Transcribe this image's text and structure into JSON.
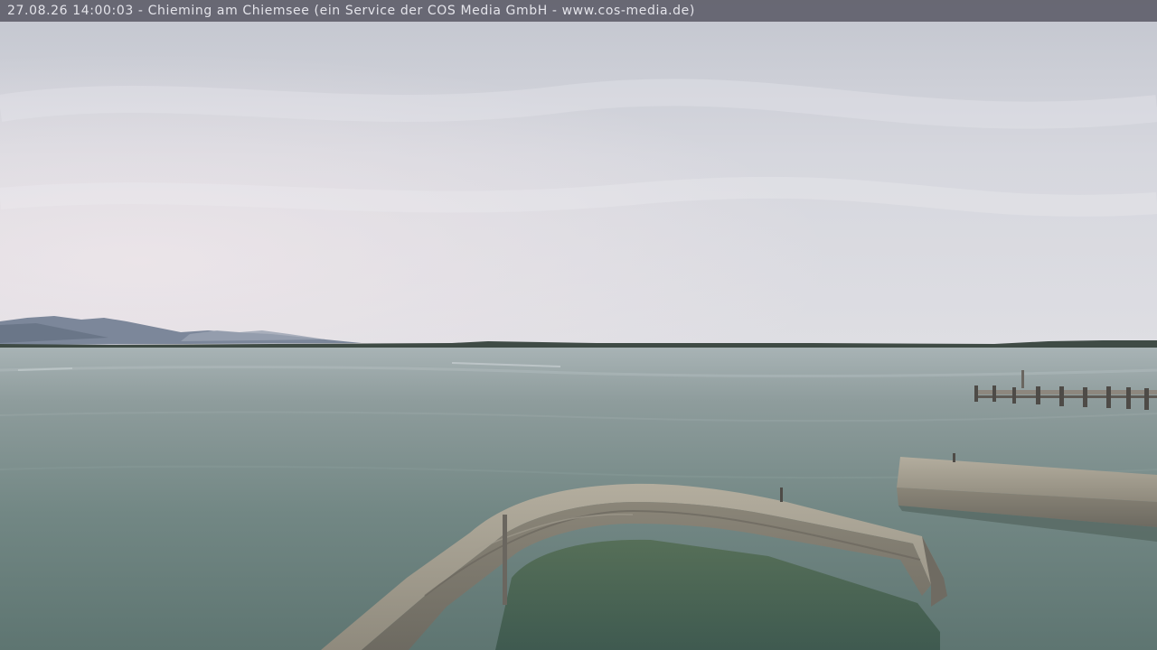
{
  "window": {
    "title": "27.08.26 14:00:03 - Chieming am Chiemsee (ein Service der COS Media GmbH - www.cos-media.de)"
  },
  "caption": {
    "text": "27.08.26 14:00:03 - Chieming am Chiemsee (ein Service der COS Media GmbH - www.cos-media.de)",
    "bar_color": "#5a5a66",
    "text_color": "#e4e4ea"
  },
  "scene": {
    "sky_color": "#d6d7de",
    "water_color": "#6f8684",
    "breakwater_color": "#8e8b80",
    "mountains_color": "#7f8a99"
  }
}
